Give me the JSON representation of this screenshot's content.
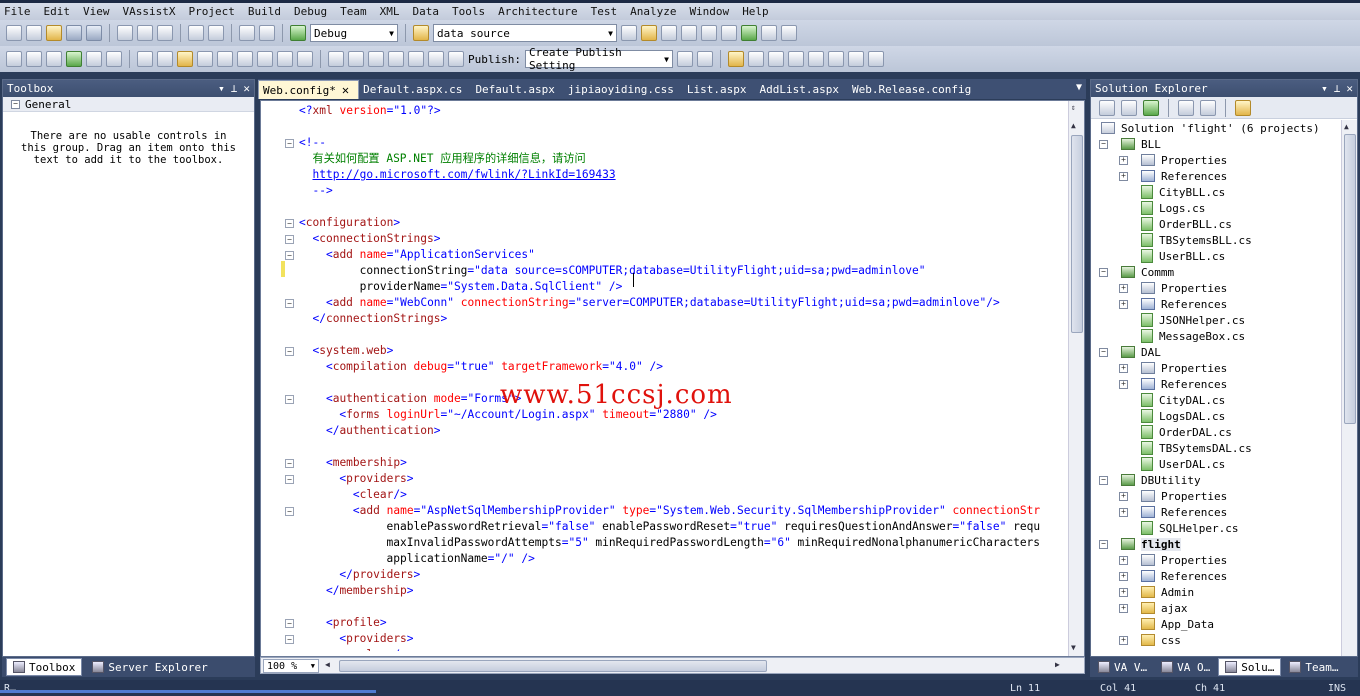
{
  "menu": [
    "File",
    "Edit",
    "View",
    "VAssistX",
    "Project",
    "Build",
    "Debug",
    "Team",
    "XML",
    "Data",
    "Tools",
    "Architecture",
    "Test",
    "Analyze",
    "Window",
    "Help"
  ],
  "toolbar1": {
    "config": "Debug",
    "search": "data source"
  },
  "toolbar2": {
    "publish_label": "Publish:",
    "publish_setting": "Create Publish Setting"
  },
  "toolbox": {
    "title": "Toolbox",
    "group": "General",
    "message": "There are no usable controls in this group. Drag an item onto this text to add it to the toolbox.",
    "tabs": [
      "Toolbox",
      "Server Explorer"
    ]
  },
  "doc_tabs": [
    "Web.config*",
    "Default.aspx.cs",
    "Default.aspx",
    "jipiaoyiding.css",
    "List.aspx",
    "AddList.aspx",
    "Web.Release.config"
  ],
  "editor": {
    "zoom": "100 %",
    "lines": [
      "<?xml version=\"1.0\"?>",
      "",
      "<!--",
      "  有关如何配置 ASP.NET 应用程序的详细信息，请访问",
      "  http://go.microsoft.com/fwlink/?LinkId=169433",
      "  -->",
      "",
      "<configuration>",
      "  <connectionStrings>",
      "    <add name=\"ApplicationServices\"",
      "         connectionString=\"data source=sCOMPUTER;database=UtilityFlight;uid=sa;pwd=adminlove\"",
      "         providerName=\"System.Data.SqlClient\" />",
      "    <add name=\"WebConn\" connectionString=\"server=COMPUTER;database=UtilityFlight;uid=sa;pwd=adminlove\"/>",
      "  </connectionStrings>",
      "",
      "  <system.web>",
      "    <compilation debug=\"true\" targetFramework=\"4.0\" />",
      "",
      "    <authentication mode=\"Forms\">",
      "      <forms loginUrl=\"~/Account/Login.aspx\" timeout=\"2880\" />",
      "    </authentication>",
      "",
      "    <membership>",
      "      <providers>",
      "        <clear/>",
      "        <add name=\"AspNetSqlMembershipProvider\" type=\"System.Web.Security.SqlMembershipProvider\" connectionStr",
      "             enablePasswordRetrieval=\"false\" enablePasswordReset=\"true\" requiresQuestionAndAnswer=\"false\" requ",
      "             maxInvalidPasswordAttempts=\"5\" minRequiredPasswordLength=\"6\" minRequiredNonalphanumericCharacters",
      "             applicationName=\"/\" />",
      "      </providers>",
      "    </membership>",
      "",
      "    <profile>",
      "      <providers>",
      "        <clear/>"
    ]
  },
  "watermark": "www.51ccsj.com",
  "solution_explorer": {
    "title": "Solution Explorer",
    "items": [
      {
        "depth": 0,
        "icon": "sln",
        "label": "Solution 'flight' (6 projects)"
      },
      {
        "depth": 1,
        "icon": "proj",
        "label": "BLL",
        "exp": "−"
      },
      {
        "depth": 2,
        "icon": "prop",
        "label": "Properties",
        "exp": "+"
      },
      {
        "depth": 2,
        "icon": "ref",
        "label": "References",
        "exp": "+"
      },
      {
        "depth": 2,
        "icon": "cs",
        "label": "CityBLL.cs"
      },
      {
        "depth": 2,
        "icon": "cs",
        "label": "Logs.cs"
      },
      {
        "depth": 2,
        "icon": "cs",
        "label": "OrderBLL.cs"
      },
      {
        "depth": 2,
        "icon": "cs",
        "label": "TBSytemsBLL.cs"
      },
      {
        "depth": 2,
        "icon": "cs",
        "label": "UserBLL.cs"
      },
      {
        "depth": 1,
        "icon": "proj",
        "label": "Commm",
        "exp": "−"
      },
      {
        "depth": 2,
        "icon": "prop",
        "label": "Properties",
        "exp": "+"
      },
      {
        "depth": 2,
        "icon": "ref",
        "label": "References",
        "exp": "+"
      },
      {
        "depth": 2,
        "icon": "cs",
        "label": "JSONHelper.cs"
      },
      {
        "depth": 2,
        "icon": "cs",
        "label": "MessageBox.cs"
      },
      {
        "depth": 1,
        "icon": "proj",
        "label": "DAL",
        "exp": "−"
      },
      {
        "depth": 2,
        "icon": "prop",
        "label": "Properties",
        "exp": "+"
      },
      {
        "depth": 2,
        "icon": "ref",
        "label": "References",
        "exp": "+"
      },
      {
        "depth": 2,
        "icon": "cs",
        "label": "CityDAL.cs"
      },
      {
        "depth": 2,
        "icon": "cs",
        "label": "LogsDAL.cs"
      },
      {
        "depth": 2,
        "icon": "cs",
        "label": "OrderDAL.cs"
      },
      {
        "depth": 2,
        "icon": "cs",
        "label": "TBSytemsDAL.cs"
      },
      {
        "depth": 2,
        "icon": "cs",
        "label": "UserDAL.cs"
      },
      {
        "depth": 1,
        "icon": "proj",
        "label": "DBUtility",
        "exp": "−"
      },
      {
        "depth": 2,
        "icon": "prop",
        "label": "Properties",
        "exp": "+"
      },
      {
        "depth": 2,
        "icon": "ref",
        "label": "References",
        "exp": "+"
      },
      {
        "depth": 2,
        "icon": "cs",
        "label": "SQLHelper.cs"
      },
      {
        "depth": 1,
        "icon": "proj",
        "label": "flight",
        "exp": "−",
        "bold": true
      },
      {
        "depth": 2,
        "icon": "prop",
        "label": "Properties",
        "exp": "+"
      },
      {
        "depth": 2,
        "icon": "ref",
        "label": "References",
        "exp": "+"
      },
      {
        "depth": 2,
        "icon": "fold",
        "label": "Admin",
        "exp": "+"
      },
      {
        "depth": 2,
        "icon": "fold",
        "label": "ajax",
        "exp": "+"
      },
      {
        "depth": 2,
        "icon": "fold",
        "label": "App_Data"
      },
      {
        "depth": 2,
        "icon": "fold",
        "label": "css",
        "exp": "+"
      }
    ],
    "tabs": [
      "VA V…",
      "VA O…",
      "Solu…",
      "Team…"
    ]
  },
  "status": {
    "left": "R…",
    "ln": "Ln 11",
    "col": "Col 41",
    "ch": "Ch 41",
    "mode": "INS"
  },
  "colors": {
    "chrome": "#2b3c59",
    "toolbar": "#c3cbdb",
    "active_tab": "#fff7d5",
    "watermark": "#e0120c"
  }
}
